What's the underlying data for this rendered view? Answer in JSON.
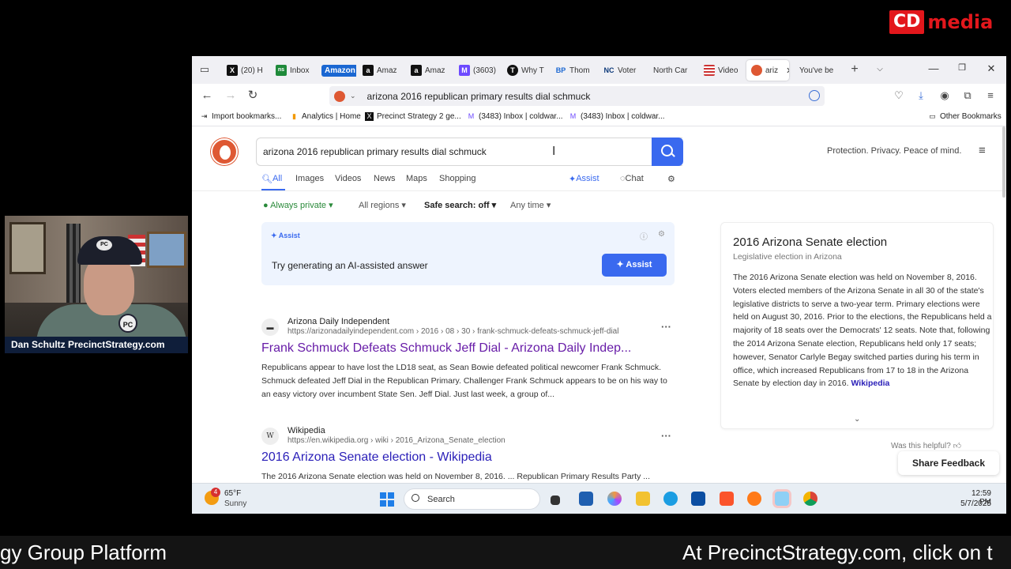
{
  "brand": {
    "box": "CD",
    "word": "media"
  },
  "webcam": {
    "caption": "Dan Schultz PrecinctStrategy.com",
    "cap_logo": "PC",
    "shirt_logo": "PC"
  },
  "tabs": [
    {
      "label": "(20) H",
      "icon": "x-icon"
    },
    {
      "label": "Inbox",
      "icon": "ns-icon"
    },
    {
      "label": "Amazon",
      "icon": "amazon-pill"
    },
    {
      "label": "Amaz",
      "icon": "amazon-icon"
    },
    {
      "label": "Amaz",
      "icon": "amazon-icon"
    },
    {
      "label": "(3603)",
      "icon": "proton-icon"
    },
    {
      "label": "Why T",
      "icon": "nyt-icon"
    },
    {
      "label": "Thom",
      "icon": "bp-icon"
    },
    {
      "label": "Voter",
      "icon": "nc-icon"
    },
    {
      "label": "North Car",
      "icon": "none"
    },
    {
      "label": "Video",
      "icon": "flag-icon"
    },
    {
      "label": "ariz",
      "icon": "duckduckgo-icon"
    },
    {
      "label": "You've be",
      "icon": "none"
    }
  ],
  "address": {
    "url": "arizona 2016 republican primary results dial schmuck"
  },
  "bookmarks": [
    {
      "label": "Import bookmarks...",
      "icon": "import-icon"
    },
    {
      "label": "Analytics | Home",
      "icon": "analytics-icon"
    },
    {
      "label": "Precinct Strategy 2 ge...",
      "icon": "x-icon"
    },
    {
      "label": "(3483) Inbox | coldwar...",
      "icon": "proton-icon"
    },
    {
      "label": "(3483) Inbox | coldwar...",
      "icon": "proton-icon"
    }
  ],
  "other_bookmarks": "Other Bookmarks",
  "search": {
    "query": "arizona 2016 republican primary results dial schmuck",
    "tagline": "Protection. Privacy. Peace of mind."
  },
  "verticals": {
    "all": "All",
    "images": "Images",
    "videos": "Videos",
    "news": "News",
    "maps": "Maps",
    "shopping": "Shopping",
    "assist": "Assist",
    "chat": "Chat"
  },
  "filters": {
    "private": "Always private",
    "regions": "All regions",
    "safe": "Safe search: off",
    "time": "Any time"
  },
  "assist_card": {
    "label": "Assist",
    "prompt": "Try generating an AI-assisted answer",
    "button": "Assist"
  },
  "results": [
    {
      "source": "Arizona Daily Independent",
      "url": "https://arizonadailyindependent.com › 2016 › 08 › 30 › frank-schmuck-defeats-schmuck-jeff-dial",
      "title": "Frank Schmuck Defeats Schmuck Jeff Dial - Arizona Daily Indep...",
      "snippet": "Republicans appear to have lost the LD18 seat, as Sean Bowie defeated political newcomer Frank Schmuck. Schmuck defeated Jeff Dial in the Republican Primary. Challenger Frank Schmuck appears to be on his way to an easy victory over incumbent State Sen. Jeff Dial. Just last week, a group of..."
    },
    {
      "source": "Wikipedia",
      "url": "https://en.wikipedia.org › wiki › 2016_Arizona_Senate_election",
      "title": "2016 Arizona Senate election - Wikipedia",
      "snippet": "The 2016 Arizona Senate election was held on November 8, 2016. ... Republican Primary Results Party ..."
    }
  ],
  "knowledge_panel": {
    "title": "2016 Arizona Senate election",
    "subtitle": "Legislative election in Arizona",
    "body": "The 2016 Arizona Senate election was held on November 8, 2016. Voters elected members of the Arizona Senate in all 30 of the state's legislative districts to serve a two-year term. Primary elections were held on August 30, 2016. Prior to the elections, the Republicans held a majority of 18 seats over the Democrats' 12 seats. Note that, following the 2014 Arizona Senate election, Republicans held only 17 seats; however, Senator Carlyle Begay switched parties during his term in office, which increased Republicans from 17 to 18 in the Arizona Senate by election day in 2016.",
    "link": "Wikipedia"
  },
  "helpful": "Was this helpful?",
  "share_feedback": "Share Feedback",
  "taskbar": {
    "temp": "65°F",
    "sky": "Sunny",
    "badge": "4",
    "search": "Search",
    "time": "12:59 PM",
    "date": "5/7/2025"
  },
  "ticker": {
    "left": "gy Group Platform",
    "right": "At PrecinctStrategy.com, click on t"
  }
}
